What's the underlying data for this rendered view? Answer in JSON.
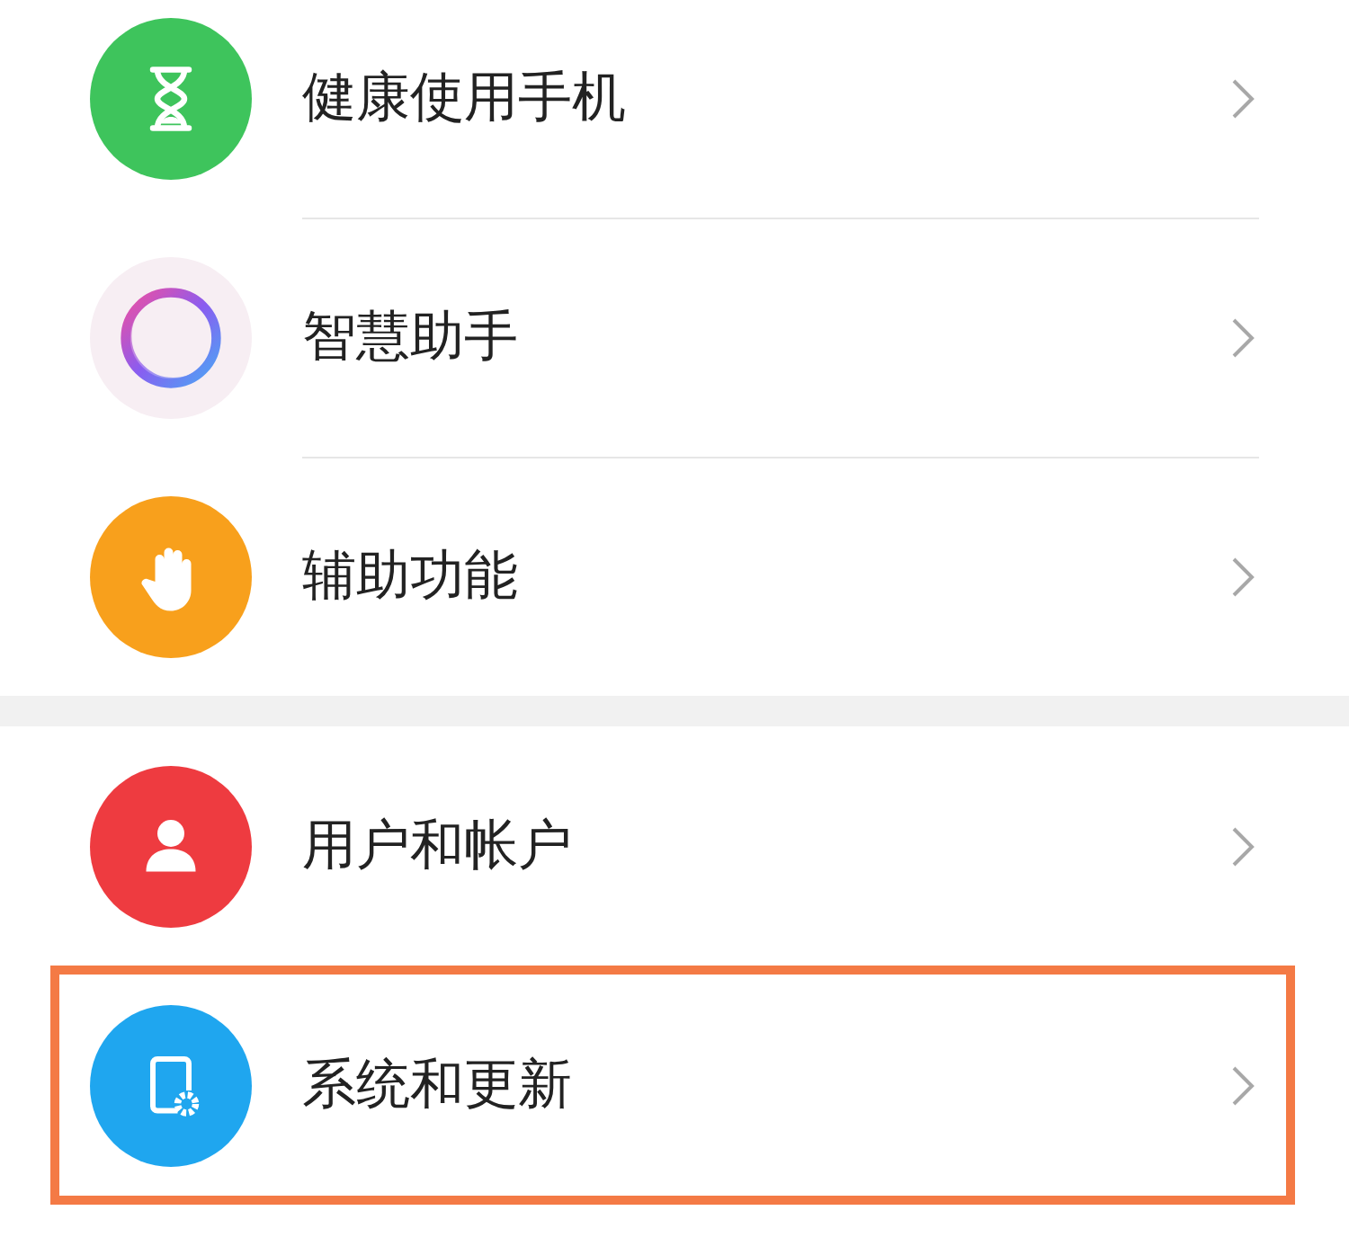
{
  "groups": [
    {
      "items": [
        {
          "label": "健康使用手机",
          "kind": "hourglass",
          "color": "#3ec45c",
          "highlighted": false
        },
        {
          "label": "智慧助手",
          "kind": "ring",
          "color": "#f7eef3",
          "highlighted": false
        },
        {
          "label": "辅助功能",
          "kind": "hand",
          "color": "#f8a01c",
          "highlighted": false
        }
      ]
    },
    {
      "items": [
        {
          "label": "用户和帐户",
          "kind": "person",
          "color": "#ee3b40",
          "highlighted": false
        },
        {
          "label": "系统和更新",
          "kind": "phone-gear",
          "color": "#1fa6ef",
          "highlighted": true
        }
      ]
    }
  ]
}
